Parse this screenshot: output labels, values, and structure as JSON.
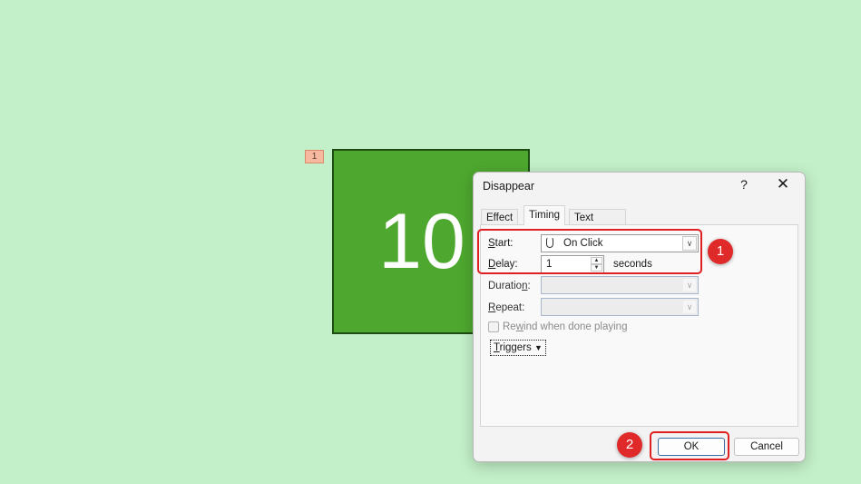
{
  "slide": {
    "animation_tag": "1",
    "shape_text": "10",
    "shape_color": "#4ea82f"
  },
  "dialog": {
    "title": "Disappear",
    "help_label": "?",
    "close_label": "✕",
    "tabs": [
      {
        "label": "Effect",
        "active": false
      },
      {
        "label": "Timing",
        "active": true
      },
      {
        "label": "Text Animation",
        "active": false
      }
    ],
    "timing": {
      "start": {
        "label_prefix": "",
        "label_accel": "S",
        "label_rest": "tart:",
        "value": "On Click",
        "icon": "mouse-icon"
      },
      "delay": {
        "label_accel": "D",
        "label_rest": "elay:",
        "value": "1",
        "unit": "seconds"
      },
      "duration": {
        "label_pre": "Duratio",
        "label_accel": "n",
        "label_post": ":",
        "value": ""
      },
      "repeat": {
        "label_accel": "R",
        "label_rest": "epeat:",
        "value": ""
      },
      "rewind": {
        "label_pre": "Re",
        "label_accel": "w",
        "label_post": "ind when done playing",
        "checked": false
      },
      "triggers": {
        "label_accel": "T",
        "label_rest": "riggers",
        "icon": "double-chevron-down-icon"
      }
    },
    "ok_label": "OK",
    "cancel_label": "Cancel"
  },
  "annotations": {
    "badge_1": "1",
    "badge_2": "2",
    "highlight_color": "#e02020"
  }
}
